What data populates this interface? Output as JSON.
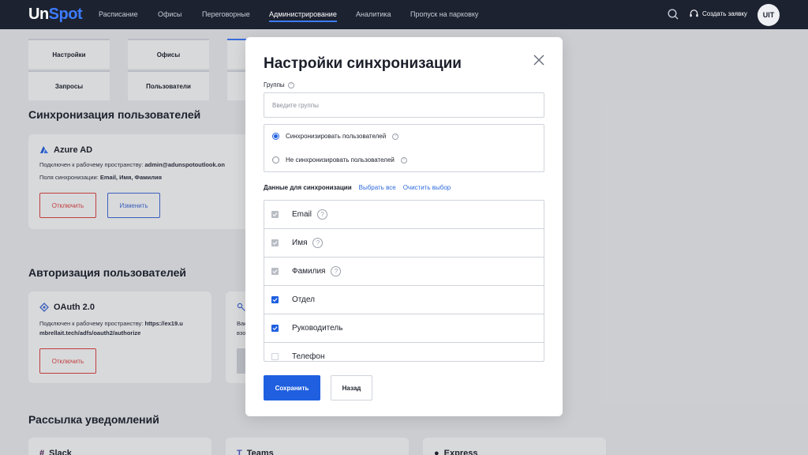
{
  "nav": {
    "logo_un": "Un",
    "logo_spot": "Spot",
    "items": [
      "Расписание",
      "Офисы",
      "Переговорные",
      "Администрирование",
      "Аналитика",
      "Пропуск на парковку"
    ],
    "create_request": "Создать заявку",
    "avatar_text": "UIT"
  },
  "background": {
    "tabs": [
      "Настройки",
      "Офисы",
      "Запросы",
      "Пользователи"
    ],
    "sync_title": "Синхронизация пользователей",
    "azure": {
      "name": "Azure AD",
      "connected_label": "Подключен к рабочему пространству:",
      "connected_value": "admin@adunspotoutlook.on",
      "fields_label": "Поля синхронизации:",
      "fields_value": "Email, Имя, Фамилия",
      "disconnect": "Отключить",
      "edit": "Изменить"
    },
    "auth_title": "Авторизация пользователей",
    "oauth": {
      "name": "OAuth 2.0",
      "connected_label": "Подключен к рабочему пространству:",
      "connected_value_1": "https://ex19.u",
      "connected_value_2": "mbrellait.tech/adfs/oauth2/authorize",
      "disconnect": "Отключить"
    },
    "partial_card_line_1": "Вак",
    "partial_card_line_2": "взо",
    "notify_title": "Рассылка уведомлений",
    "notify_items": [
      "Slack",
      "Teams",
      "Express"
    ]
  },
  "modal": {
    "title": "Настройки синхронизации",
    "groups_label": "Группы",
    "groups_placeholder": "Введите группы",
    "groups_value": "",
    "radio_sync": "Синхронизировать пользователей",
    "radio_nosync": "Не синхронизировать пользователей",
    "selected_radio": "sync",
    "data_label": "Данные для синхронизации",
    "select_all": "Выбрать все",
    "clear_selection": "Очистить выбор",
    "fields": [
      {
        "label": "Email",
        "state": "disabled",
        "help": true
      },
      {
        "label": "Имя",
        "state": "disabled",
        "help": true
      },
      {
        "label": "Фамилия",
        "state": "disabled",
        "help": true
      },
      {
        "label": "Отдел",
        "state": "checked",
        "help": false
      },
      {
        "label": "Руководитель",
        "state": "checked",
        "help": false
      },
      {
        "label": "Телефон",
        "state": "empty",
        "help": false
      }
    ],
    "save": "Сохранить",
    "back": "Назад"
  },
  "colors": {
    "nav_bg": "#1c2230",
    "accent": "#1f5fe0",
    "danger": "#e3423f"
  }
}
